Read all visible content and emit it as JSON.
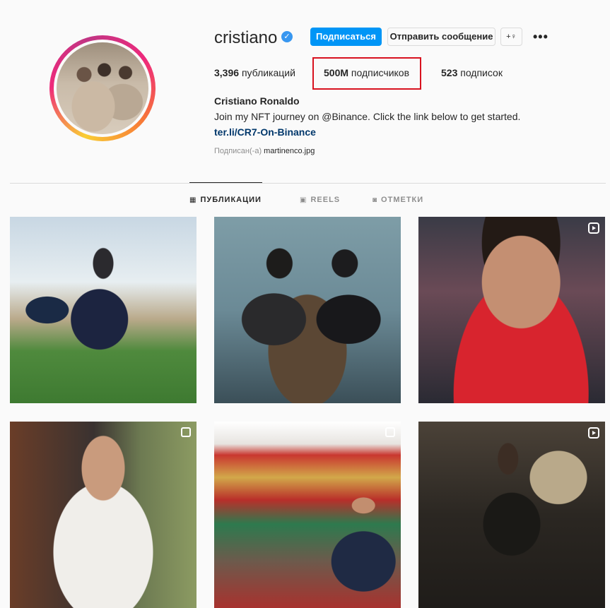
{
  "profile": {
    "username": "cristiano",
    "verified_icon": "verified-badge-icon",
    "full_name": "Cristiano Ronaldo",
    "bio": "Join my NFT journey on @Binance. Click the link below to get started.",
    "link": "ter.li/CR7-On-Binance",
    "followed_by_prefix": "Подписан(-а)",
    "followed_by_user": "martinenco.jpg"
  },
  "actions": {
    "follow_label": "Подписаться",
    "message_label": "Отправить сообщение",
    "suggest_icon": "add-user-icon",
    "suggest_label": "+♀",
    "more_label": "•••"
  },
  "stats": {
    "posts_count": "3,396",
    "posts_label": "публикаций",
    "followers_count": "500M",
    "followers_label": "подписчиков",
    "following_count": "523",
    "following_label": "подписок"
  },
  "tabs": [
    {
      "label": "ПУБЛИКАЦИИ",
      "icon": "grid-icon",
      "glyph": "▦",
      "active": true
    },
    {
      "label": "REELS",
      "icon": "reels-icon",
      "glyph": "▣",
      "active": false
    },
    {
      "label": "ОТМЕТКИ",
      "icon": "tag-icon",
      "glyph": "◙",
      "active": false
    }
  ],
  "posts": [
    {
      "overlay": "none"
    },
    {
      "overlay": "none"
    },
    {
      "overlay": "reel-icon"
    },
    {
      "overlay": "multi-icon"
    },
    {
      "overlay": "multi-icon"
    },
    {
      "overlay": "reel-icon"
    }
  ],
  "colors": {
    "accent": "#0095f6",
    "highlight": "#d8121f",
    "link": "#00376b"
  }
}
